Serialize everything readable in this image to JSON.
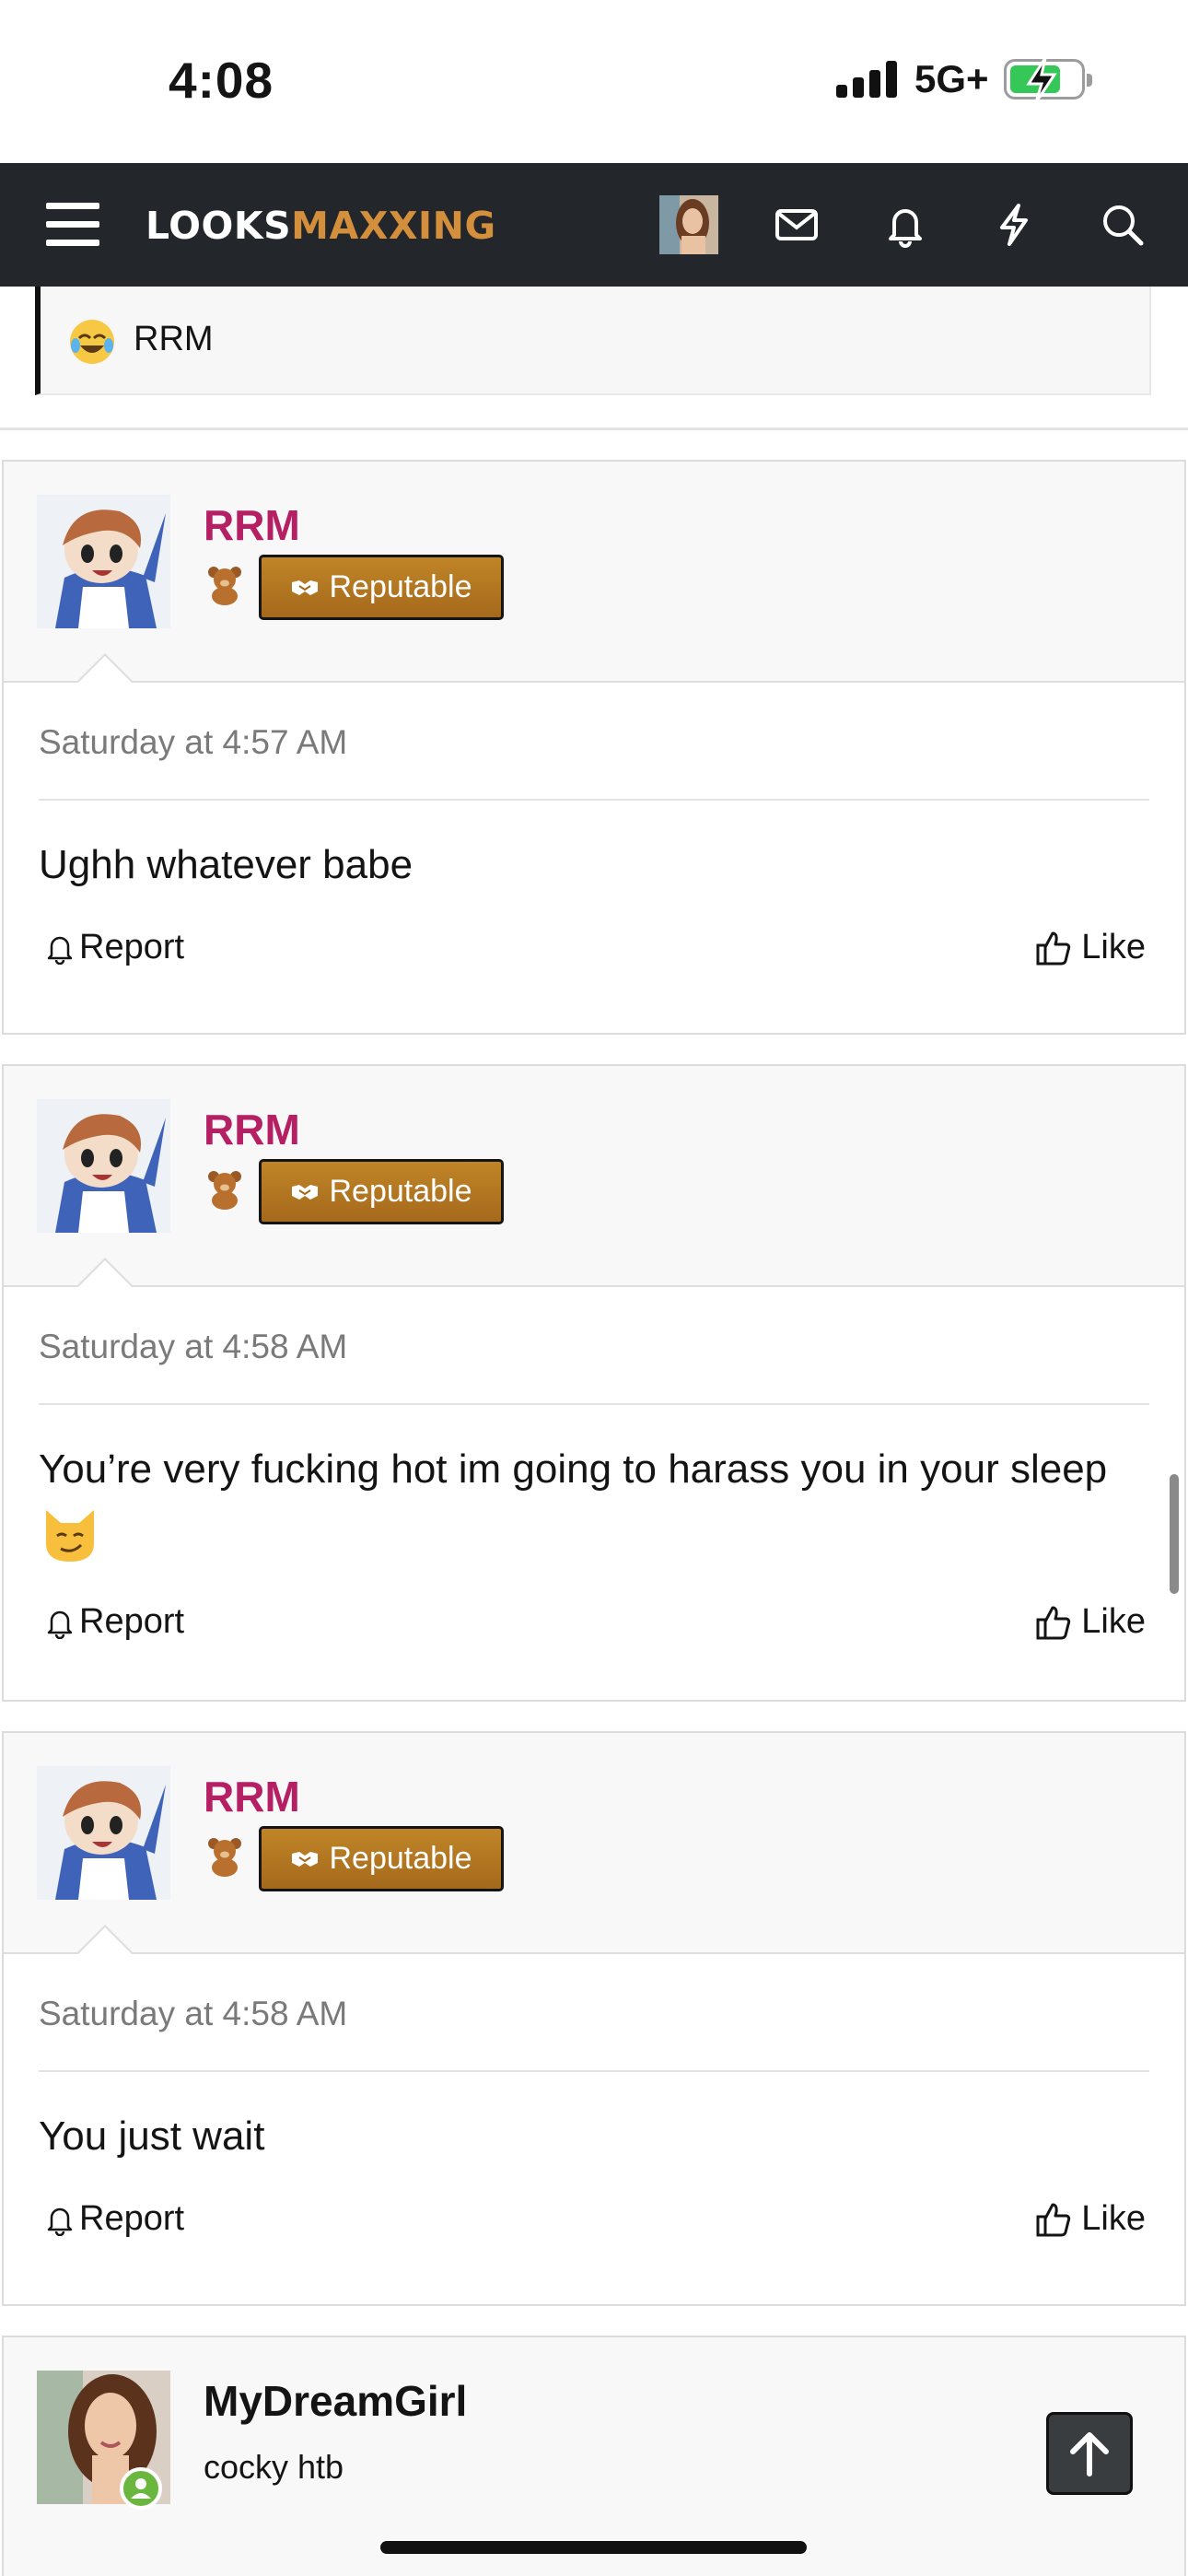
{
  "status_bar": {
    "time": "4:08",
    "network": "5G+",
    "battery_charging": true
  },
  "navbar": {
    "logo_part1": "LOOKS",
    "logo_part2": "MAXXING",
    "icons": [
      "menu-icon",
      "avatar",
      "mail-icon",
      "bell-icon",
      "bolt-icon",
      "search-icon"
    ],
    "background": "#23262a",
    "accent": "#d38f3b"
  },
  "quote": {
    "text": "RRM"
  },
  "posts": [
    {
      "username": "RRM",
      "badge": "Reputable",
      "date": "Saturday at 4:57 AM",
      "message": "Ughh whatever babe",
      "report_label": "Report",
      "like_label": "Like"
    },
    {
      "username": "RRM",
      "badge": "Reputable",
      "date": "Saturday at 4:58 AM",
      "message": "You’re very fucking hot im going to harass you in your sleep",
      "report_label": "Report",
      "like_label": "Like"
    },
    {
      "username": "RRM",
      "badge": "Reputable",
      "date": "Saturday at 4:58 AM",
      "message": "You just wait",
      "report_label": "Report",
      "like_label": "Like"
    },
    {
      "username": "MyDreamGirl",
      "user_title": "cocky htb"
    }
  ],
  "colors": {
    "username": "#b51f63",
    "badge": "#b07325"
  }
}
